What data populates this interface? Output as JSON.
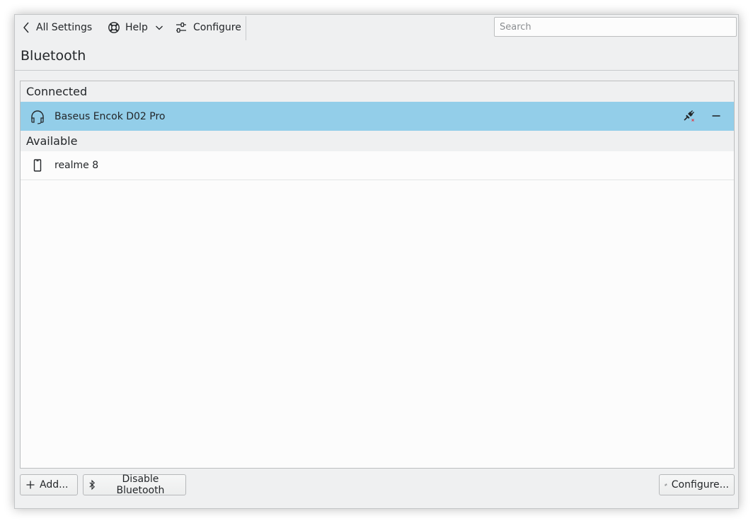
{
  "toolbar": {
    "all_settings_label": "All Settings",
    "help_label": "Help",
    "configure_label": "Configure",
    "search_placeholder": "Search"
  },
  "page": {
    "title": "Bluetooth"
  },
  "sections": {
    "connected": {
      "label": "Connected",
      "devices": [
        {
          "name": "Baseus Encok D02 Pro",
          "icon": "headphones-icon",
          "selected": true
        }
      ]
    },
    "available": {
      "label": "Available",
      "devices": [
        {
          "name": "realme 8",
          "icon": "phone-icon",
          "selected": false
        }
      ]
    }
  },
  "footer": {
    "add_label": "Add...",
    "disable_label": "Disable Bluetooth",
    "configure_label": "Configure..."
  },
  "colors": {
    "window_bg": "#eff0f1",
    "selection": "#93cee9",
    "list_bg": "#fcfcfc",
    "text": "#232629",
    "disconnect_accent": "#da4453"
  }
}
